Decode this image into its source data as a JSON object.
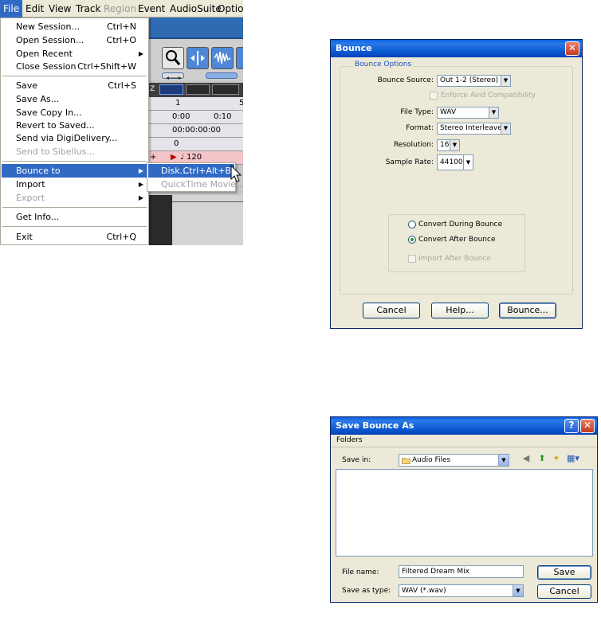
{
  "menubar": {
    "items": [
      {
        "label": "File",
        "state": "active"
      },
      {
        "label": "Edit",
        "state": "normal"
      },
      {
        "label": "View",
        "state": "normal"
      },
      {
        "label": "Track",
        "state": "normal"
      },
      {
        "label": "Region",
        "state": "disabled"
      },
      {
        "label": "Event",
        "state": "normal"
      },
      {
        "label": "AudioSuite",
        "state": "normal"
      },
      {
        "label": "Option",
        "state": "normal"
      }
    ]
  },
  "file_menu": {
    "items": [
      {
        "label": "New Session...",
        "shortcut": "Ctrl+N"
      },
      {
        "label": "Open Session...",
        "shortcut": "Ctrl+O"
      },
      {
        "label": "Open Recent",
        "shortcut": ""
      },
      {
        "label": "Close Session",
        "shortcut": "Ctrl+Shift+W"
      },
      {
        "label": "Save",
        "shortcut": "Ctrl+S"
      },
      {
        "label": "Save As...",
        "shortcut": ""
      },
      {
        "label": "Save Copy In...",
        "shortcut": ""
      },
      {
        "label": "Revert to Saved...",
        "shortcut": ""
      },
      {
        "label": "Send via DigiDelivery...",
        "shortcut": ""
      },
      {
        "label": "Send to Sibelius...",
        "shortcut": ""
      },
      {
        "label": "Bounce to",
        "shortcut": ""
      },
      {
        "label": "Import",
        "shortcut": ""
      },
      {
        "label": "Export",
        "shortcut": ""
      },
      {
        "label": "Get Info...",
        "shortcut": ""
      },
      {
        "label": "Exit",
        "shortcut": "Ctrl+Q"
      }
    ]
  },
  "bounce_submenu": {
    "items": [
      {
        "label": "Disk...",
        "shortcut": "Ctrl+Alt+B"
      },
      {
        "label": "QuickTime Movie...",
        "shortcut": ""
      }
    ]
  },
  "pro_tools_bg": {
    "ruler": {
      "bar": "1",
      "bar2": "5"
    },
    "timecode": {
      "t0": "0:00",
      "t1": "0:10"
    },
    "counter": "00:00:00:00",
    "meter_zero": "0",
    "tempo": "120",
    "zoom_z": "Z",
    "plus": "+"
  },
  "bounce_dialog": {
    "title": "Bounce",
    "group_title": "Bounce Options",
    "source": {
      "label": "Bounce Source:",
      "value": "Out 1-2 (Stereo)"
    },
    "enforce_avid": "Enforce Avid Compatibility",
    "file_type": {
      "label": "File Type:",
      "value": "WAV"
    },
    "format": {
      "label": "Format:",
      "value": "Stereo Interleaved"
    },
    "resolution": {
      "label": "Resolution:",
      "value": "16"
    },
    "sample_rate": {
      "label": "Sample Rate:",
      "value": "44100"
    },
    "convert_during": "Convert During Bounce",
    "convert_after": "Convert After Bounce",
    "import_after": "Import After Bounce",
    "buttons": {
      "cancel": "Cancel",
      "help": "Help...",
      "bounce": "Bounce..."
    },
    "close_glyph": "✕"
  },
  "save_dialog": {
    "title": "Save Bounce As",
    "folders_menu": "Folders",
    "save_in": {
      "label": "Save in:",
      "value": "Audio Files"
    },
    "file_name": {
      "label": "File name:",
      "value": "Filtered Dream Mix"
    },
    "save_as_type": {
      "label": "Save as type:",
      "value": "WAV (*.wav)"
    },
    "buttons": {
      "save": "Save",
      "cancel": "Cancel"
    },
    "help_glyph": "?",
    "close_glyph": "✕"
  },
  "colors": {
    "menu_highlight": "#316ac5",
    "xp_title": "#0a58d0",
    "dialog_bg": "#ece9d8",
    "group_title": "#1f4fbf"
  }
}
